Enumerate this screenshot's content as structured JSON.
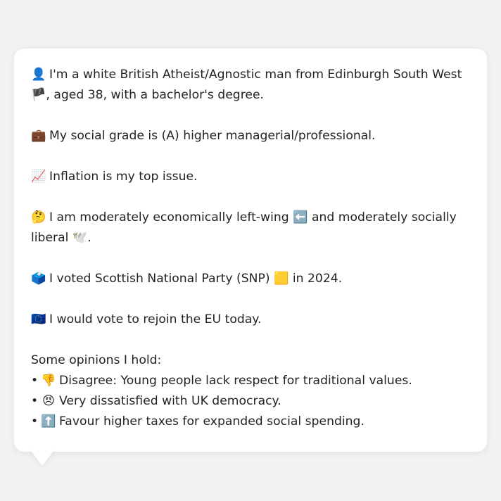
{
  "profile": {
    "identity_icon": "👤",
    "identity_text": "I'm a white British Atheist/Agnostic man from Edinburgh South West 🏴, aged 38, with a bachelor's degree.",
    "grade_icon": "💼",
    "grade_text": "My social grade is (A) higher managerial/professional.",
    "issue_icon": "📈",
    "issue_text": "Inflation is my top issue.",
    "ideology_icon": "🤔",
    "ideology_text": "I am moderately economically left-wing ⬅️ and moderately socially liberal 🕊️.",
    "vote_icon": "🗳️",
    "vote_text": "I voted Scottish National Party (SNP) 🟨 in 2024.",
    "eu_icon": "🇪🇺",
    "eu_text": "I would vote to rejoin the EU today."
  },
  "opinions": {
    "heading": "Some opinions I hold:",
    "items": [
      {
        "bullet": "•",
        "icon": "👎",
        "text": "Disagree: Young people lack respect for traditional values."
      },
      {
        "bullet": "•",
        "icon": "😠",
        "text": "Very dissatisfied with UK democracy."
      },
      {
        "bullet": "•",
        "icon": "⬆️",
        "text": "Favour higher taxes for expanded social spending."
      }
    ]
  }
}
